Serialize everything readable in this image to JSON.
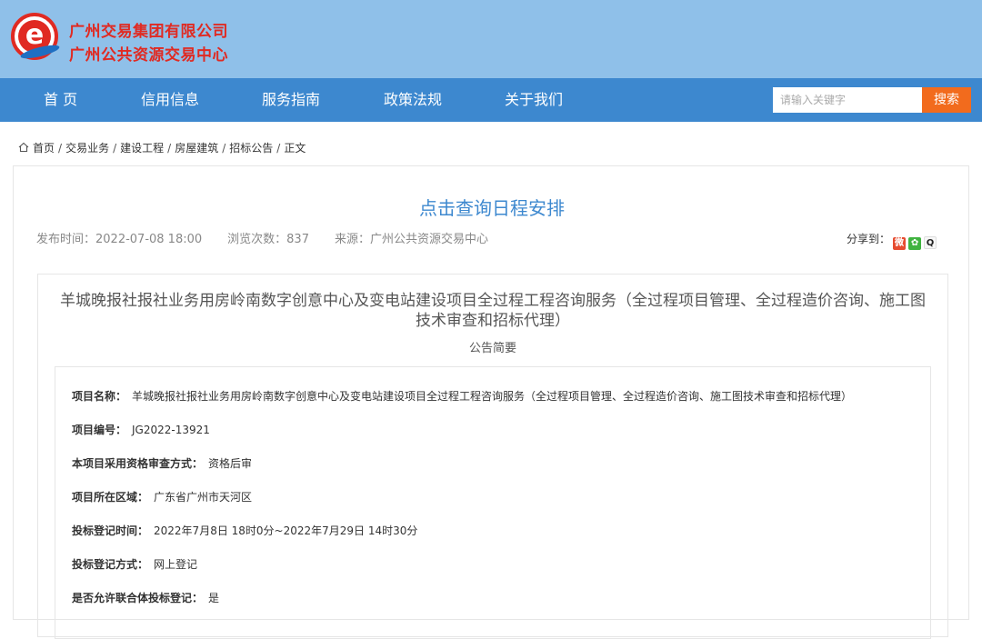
{
  "brand": {
    "line1": "广州交易集团有限公司",
    "line2": "广州公共资源交易中心",
    "logo_letter": "e"
  },
  "nav": {
    "items": [
      "首 页",
      "信用信息",
      "服务指南",
      "政策法规",
      "关于我们"
    ],
    "search_placeholder": "请输入关键字",
    "search_button": "搜索"
  },
  "breadcrumb": {
    "items": [
      "首页",
      "交易业务",
      "建设工程",
      "房屋建筑",
      "招标公告",
      "正文"
    ],
    "separator": "/"
  },
  "article": {
    "title": "点击查询日程安排",
    "publish_time": "发布时间：2022-07-08 18:00",
    "views": "浏览次数：837",
    "source": "来源：广州公共资源交易中心",
    "share_label": "分享到："
  },
  "notice": {
    "title": "羊城晚报社报社业务用房岭南数字创意中心及变电站建设项目全过程工程咨询服务（全过程项目管理、全过程造价咨询、施工图技术审查和招标代理）",
    "subtitle": "公告简要",
    "fields": [
      {
        "label": "项目名称：",
        "value": "羊城晚报社报社业务用房岭南数字创意中心及变电站建设项目全过程工程咨询服务（全过程项目管理、全过程造价咨询、施工图技术审查和招标代理）"
      },
      {
        "label": "项目编号：",
        "value": "JG2022-13921"
      },
      {
        "label": "本项目采用资格审查方式：",
        "value": "资格后审"
      },
      {
        "label": "项目所在区域：",
        "value": "广东省广州市天河区"
      },
      {
        "label": "投标登记时间：",
        "value": "2022年7月8日 18时0分~2022年7月29日 14时30分"
      },
      {
        "label": "投标登记方式：",
        "value": "网上登记"
      },
      {
        "label": "是否允许联合体投标登记：",
        "value": "是"
      }
    ]
  },
  "colors": {
    "header_bg": "#8fc0e9",
    "nav_bg": "#3d88cf",
    "brand_red": "#e02a22",
    "search_orange": "#f26b1d",
    "title_blue": "#3d88cf"
  },
  "share_icons": [
    "weibo-icon",
    "wechat-icon",
    "qq-icon"
  ]
}
